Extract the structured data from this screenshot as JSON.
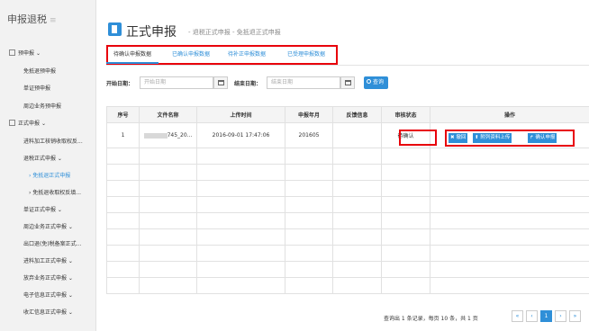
{
  "sidebar": {
    "title": "申报退税",
    "menu_icon": "hamburger-icon",
    "items": [
      {
        "label": "预申报",
        "level": 1,
        "expand": "⌄"
      },
      {
        "label": "免抵退预申报",
        "level": 2
      },
      {
        "label": "单证预申报",
        "level": 2
      },
      {
        "label": "周边业务预申报",
        "level": 2
      },
      {
        "label": "正式申报",
        "level": 1,
        "expand": "⌄"
      },
      {
        "label": "进料加工核销收取权反...",
        "level": 2
      },
      {
        "label": "退税正式申报 ⌄",
        "level": 2
      },
      {
        "label": "› 免抵退正式申报",
        "level": 3,
        "active": true
      },
      {
        "label": "› 免抵退收取权反填...",
        "level": 3
      },
      {
        "label": "单证正式申报 ⌄",
        "level": 2
      },
      {
        "label": "周边业务正式申报 ⌄",
        "level": 2
      },
      {
        "label": "出口退(免)税备案正式...",
        "level": 2
      },
      {
        "label": "进料加工正式申报 ⌄",
        "level": 2
      },
      {
        "label": "放弃业务正式申报 ⌄",
        "level": 2
      },
      {
        "label": "电子信息正式申报 ⌄",
        "level": 2
      },
      {
        "label": "收汇信息正式申报 ⌄",
        "level": 2
      }
    ]
  },
  "header": {
    "title": "正式申报",
    "subtitle": "- 退税正式申报 - 免抵退正式申报"
  },
  "tabs": [
    "待确认申报数据",
    "已确认申报数据",
    "待补正申报数据",
    "已受理申报数据"
  ],
  "filter": {
    "start_label": "开始日期：",
    "start_placeholder": "开始日期",
    "end_label": "结束日期：",
    "end_placeholder": "结束日期",
    "query_label": "查询"
  },
  "table": {
    "columns": [
      "序号",
      "文件名称",
      "上传时间",
      "申报年月",
      "反馈信息",
      "审核状态",
      "操作"
    ],
    "rows": [
      {
        "index": "1",
        "filename": "745_20...",
        "upload_time": "2016-09-01 17:47:06",
        "period": "201605",
        "feedback": "",
        "status": "待确认"
      }
    ],
    "actions": [
      "✖ 撤回",
      "⬆ 附列资料上传",
      "↱ 确认申报"
    ]
  },
  "pager": {
    "summary": "查询出 1 条记录，每页 10 条，共 1 页",
    "first": "«",
    "prev": "‹",
    "current": "1",
    "next": "›",
    "last": "»"
  },
  "colors": {
    "accent": "#2f8fd8",
    "highlight": "#e8000b"
  }
}
